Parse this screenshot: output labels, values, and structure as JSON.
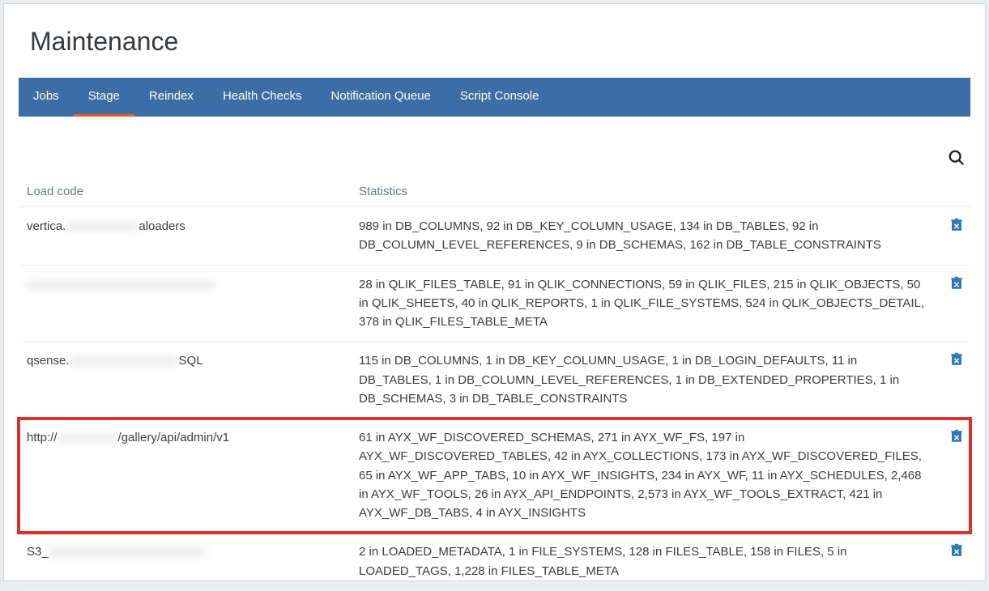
{
  "page_title": "Maintenance",
  "tabs": [
    {
      "id": "jobs",
      "label": "Jobs"
    },
    {
      "id": "stage",
      "label": "Stage"
    },
    {
      "id": "reindex",
      "label": "Reindex"
    },
    {
      "id": "health",
      "label": "Health Checks"
    },
    {
      "id": "notif",
      "label": "Notification Queue"
    },
    {
      "id": "script",
      "label": "Script Console"
    }
  ],
  "active_tab": "stage",
  "columns": {
    "loadcode": "Load code",
    "stats": "Statistics"
  },
  "rows": [
    {
      "load_pre": "vertica.",
      "load_blur": "xxxxxxxxxxxx",
      "load_post": "aloaders",
      "stats": "989 in DB_COLUMNS, 92 in DB_KEY_COLUMN_USAGE, 134 in DB_TABLES, 92 in DB_COLUMN_LEVEL_REFERENCES, 9 in DB_SCHEMAS, 162 in DB_TABLE_CONSTRAINTS"
    },
    {
      "load_pre": "",
      "load_blur": "xxxxxxxxxxxxxxxxxxxxxxxxxxxxxxx",
      "load_post": "",
      "stats": "28 in QLIK_FILES_TABLE, 91 in QLIK_CONNECTIONS, 59 in QLIK_FILES, 215 in QLIK_OBJECTS, 50 in QLIK_SHEETS, 40 in QLIK_REPORTS, 1 in QLIK_FILE_SYSTEMS, 524 in QLIK_OBJECTS_DETAIL, 378 in QLIK_FILES_TABLE_META"
    },
    {
      "load_pre": "qsense.",
      "load_blur": "xxxxxxxxxxxxxxxxxx",
      "load_post": "SQL",
      "stats": "115 in DB_COLUMNS, 1 in DB_KEY_COLUMN_USAGE, 1 in DB_LOGIN_DEFAULTS, 11 in DB_TABLES, 1 in DB_COLUMN_LEVEL_REFERENCES, 1 in DB_EXTENDED_PROPERTIES, 1 in DB_SCHEMAS, 3 in DB_TABLE_CONSTRAINTS"
    },
    {
      "load_pre": "http://",
      "load_blur": "xxxxxxxxxx",
      "load_post": "/gallery/api/admin/v1",
      "stats": "61 in AYX_WF_DISCOVERED_SCHEMAS, 271 in AYX_WF_FS, 197 in AYX_WF_DISCOVERED_TABLES, 42 in AYX_COLLECTIONS, 173 in AYX_WF_DISCOVERED_FILES, 65 in AYX_WF_APP_TABS, 10 in AYX_WF_INSIGHTS, 234 in AYX_WF, 11 in AYX_SCHEDULES, 2,468 in AYX_WF_TOOLS, 26 in AYX_API_ENDPOINTS, 2,573 in AYX_WF_TOOLS_EXTRACT, 421 in AYX_WF_DB_TABS, 4 in AYX_INSIGHTS",
      "highlighted": true
    },
    {
      "load_pre": "S3_",
      "load_blur": "xxxxxxxxxxxxxxxxxxxxxxxxxx",
      "load_post": "",
      "stats": "2 in LOADED_METADATA, 1 in FILE_SYSTEMS, 128 in FILES_TABLE, 158 in FILES, 5 in LOADED_TAGS, 1,228 in FILES_TABLE_META"
    }
  ]
}
